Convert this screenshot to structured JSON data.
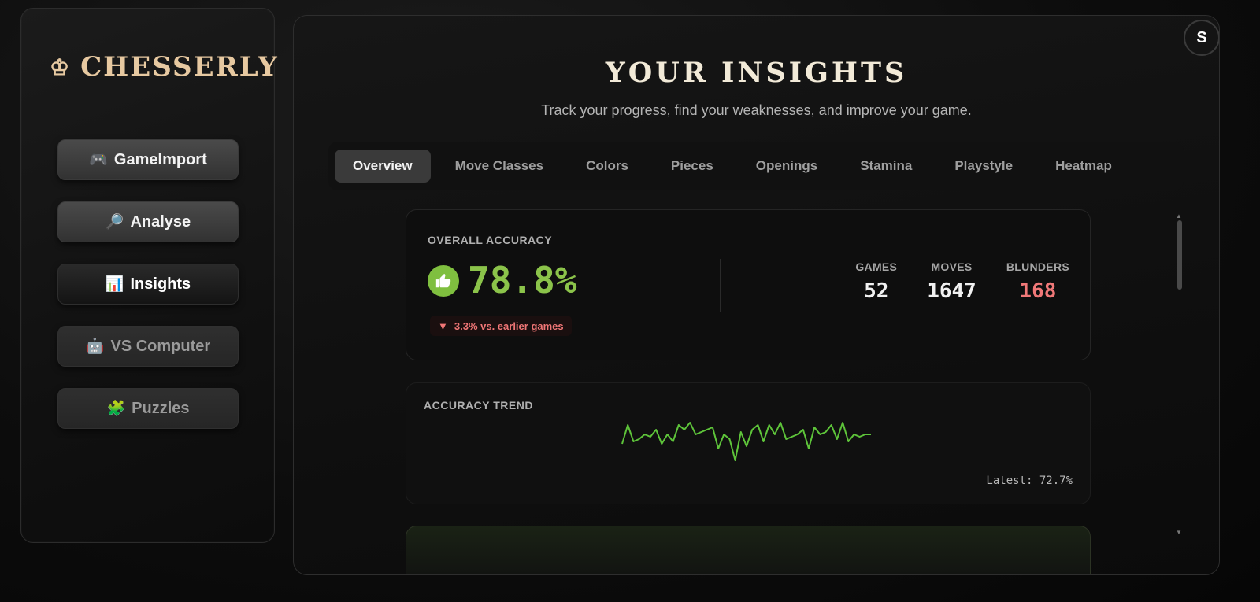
{
  "brand": {
    "icon": "crown-icon",
    "glyph": "♔",
    "name": "CHESSERLY"
  },
  "nav": [
    {
      "emoji": "🎮",
      "label": "GameImport",
      "state": "normal"
    },
    {
      "emoji": "🔎",
      "label": "Analyse",
      "state": "normal"
    },
    {
      "emoji": "📊",
      "label": "Insights",
      "state": "active"
    },
    {
      "emoji": "🤖",
      "label": "VS Computer",
      "state": "disabled"
    },
    {
      "emoji": "🧩",
      "label": "Puzzles",
      "state": "disabled"
    }
  ],
  "user": {
    "initial": "S"
  },
  "header": {
    "title": "YOUR INSIGHTS",
    "subtitle": "Track your progress, find your weaknesses, and improve your game."
  },
  "tabs": [
    "Overview",
    "Move Classes",
    "Colors",
    "Pieces",
    "Openings",
    "Stamina",
    "Playstyle",
    "Heatmap"
  ],
  "active_tab": "Overview",
  "accuracy": {
    "label": "OVERALL ACCURACY",
    "value": "78.8%",
    "delta_arrow": "▼",
    "delta_text": "3.3% vs. earlier games",
    "stats": [
      {
        "label": "GAMES",
        "value": "52",
        "color": "#f1f1f1"
      },
      {
        "label": "MOVES",
        "value": "1647",
        "color": "#f1f1f1"
      },
      {
        "label": "BLUNDERS",
        "value": "168",
        "color": "#f07878"
      }
    ]
  },
  "trend": {
    "label": "ACCURACY TREND",
    "latest": "Latest: 72.7%",
    "line_color": "#5ec43a",
    "points": [
      76,
      84,
      77,
      78,
      80,
      79,
      82,
      76,
      80,
      77,
      84,
      82,
      85,
      80,
      81,
      82,
      83,
      74,
      80,
      78,
      69,
      81,
      75,
      82,
      84,
      77,
      84,
      80,
      85,
      78,
      79,
      80,
      82,
      74,
      83,
      80,
      81,
      84,
      78,
      85,
      77,
      80,
      79,
      80,
      80
    ]
  },
  "colors": {
    "accent": "#e7c9a1",
    "good": "#8bc34a",
    "bad": "#f07676"
  }
}
